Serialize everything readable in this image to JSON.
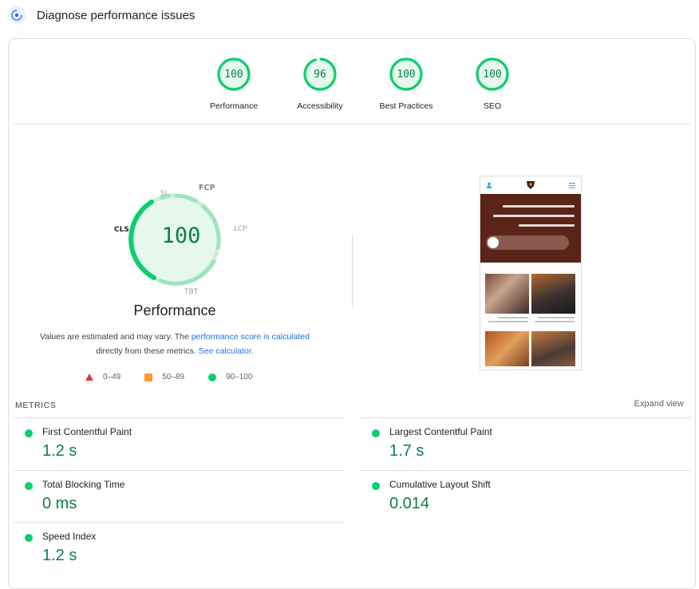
{
  "header": {
    "title": "Diagnose performance issues",
    "icon": "lighthouse-icon"
  },
  "categories": [
    {
      "label": "Performance",
      "score": "100",
      "fraction": 1.0
    },
    {
      "label": "Accessibility",
      "score": "96",
      "fraction": 0.96
    },
    {
      "label": "Best Practices",
      "score": "100",
      "fraction": 1.0
    },
    {
      "label": "SEO",
      "score": "100",
      "fraction": 1.0
    }
  ],
  "performance": {
    "score": "100",
    "title": "Performance",
    "gauge_labels": {
      "fcp": "FCP",
      "si": "SI",
      "lcp": "LCP",
      "tbt": "TBT",
      "cls": "CLS"
    },
    "note_part1": "Values are estimated and may vary. The ",
    "note_link1": "performance score is calculated",
    "note_part2": " directly from these metrics. ",
    "note_link2": "See calculator."
  },
  "legend": [
    {
      "range": "0–49",
      "shape": "triangle",
      "color": "#e53935"
    },
    {
      "range": "50–89",
      "shape": "square",
      "color": "#fb9a2f"
    },
    {
      "range": "90–100",
      "shape": "circle",
      "color": "#0cce6b"
    }
  ],
  "metrics": {
    "heading": "METRICS",
    "expand_label": "Expand view",
    "items": [
      {
        "name": "First Contentful Paint",
        "value": "1.2 s"
      },
      {
        "name": "Largest Contentful Paint",
        "value": "1.7 s"
      },
      {
        "name": "Total Blocking Time",
        "value": "0 ms"
      },
      {
        "name": "Cumulative Layout Shift",
        "value": "0.014"
      },
      {
        "name": "Speed Index",
        "value": "1.2 s"
      }
    ]
  },
  "colors": {
    "pass": "#0cce6b",
    "pass_text": "#0b8043",
    "link": "#1a73e8",
    "hero": "#5a2419"
  }
}
